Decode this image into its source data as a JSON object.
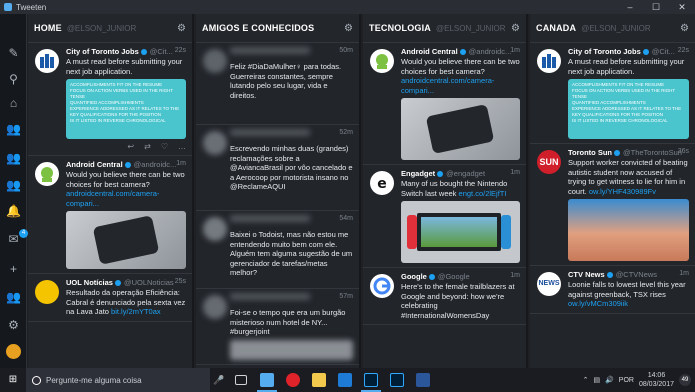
{
  "window": {
    "title": "Tweeten"
  },
  "columns": [
    {
      "title": "HOME",
      "handle": "@ELSON_JUNIOR"
    },
    {
      "title": "AMIGOS E CONHECIDOS",
      "handle": ""
    },
    {
      "title": "TECNOLOGIA",
      "handle": "@ELSON_JUNIOR"
    },
    {
      "title": "CANADA",
      "handle": "@ELSON_JUNIOR"
    }
  ],
  "home": [
    {
      "name": "City of Toronto Jobs",
      "handle": "@Cit...",
      "time": "22s",
      "text": "A must read before submitting your next job application."
    },
    {
      "name": "Android Central",
      "handle": "@androidc...",
      "time": "1m",
      "text": "Would you believe there can be two choices for best camera?",
      "link": "androidcentral.com/camera-compari..."
    },
    {
      "name": "UOL Notícias",
      "handle": "@UOLNoticias",
      "time": "25s",
      "text": "Resultado da operação Eficiência: Cabral é denunciado pela sexta vez na Lava Jato",
      "link": "bit.ly/2mYT0ax"
    }
  ],
  "amigos": [
    {
      "time": "50m",
      "text": "Feliz #DiaDaMulher♀ para todas. Guerreiras constantes, sempre lutando pelo seu lugar, vida e direitos."
    },
    {
      "time": "52m",
      "text": "Escrevendo minhas duas (grandes) reclamações sobre a @AviancaBrasil por vôo cancelado e a Aerocoop por motorista insano no @ReclameAQUI"
    },
    {
      "time": "54m",
      "text": "Baixei o Todoist, mas não estou me entendendo muito bem com ele. Alguém tem alguma sugestão de um gerenciador de tarefas/metas melhor?"
    },
    {
      "time": "57m",
      "text": "Foi-se o tempo que era um burgão misterioso num hotel de NY... #burgerjoint"
    }
  ],
  "tecnologia": [
    {
      "name": "Android Central",
      "handle": "@androidc...",
      "time": "1m",
      "text": "Would you believe there can be two choices for best camera?",
      "link": "androidcentral.com/camera-compari..."
    },
    {
      "name": "Engadget",
      "handle": "@engadget",
      "time": "1m",
      "text": "Many of us bought the Nintendo Switch last week",
      "link": "engt.co/2lEjfTI"
    },
    {
      "name": "Google",
      "handle": "@Google",
      "time": "1m",
      "text": "Here's to the female trailblazers at Google and beyond: how we're celebrating #InternationalWomensDay"
    }
  ],
  "canada": [
    {
      "name": "City of Toronto Jobs",
      "handle": "@Cit...",
      "time": "22s",
      "text": "A must read before submitting your next job application."
    },
    {
      "name": "Toronto Sun",
      "handle": "@TheTorontoSun",
      "time": "36s",
      "text": "Support worker convicted of beating autistic student now accused of trying to get witness to lie for him in court.",
      "link": "ow.ly/YHF430989Fv"
    },
    {
      "name": "CTV News",
      "handle": "@CTVNews",
      "time": "1m",
      "text": "Loonie falls to lowest level this year against greenback, TSX rises",
      "link": "ow.ly/vMCm309iik"
    }
  ],
  "job_card_lines": [
    "ACCOMPLISHMENTS FIT ON THE RESUME",
    "FOCUS ON ACTION VERBS USED IN THE RIGHT TENSE",
    "QUANTIFIED ACCOMPLISHMENTS",
    "EXPERIENCE ADDRESSED AS IT RELATES TO THE KEY QUALIFICATIONS FOR THE POSITION",
    "IS IT LISTED IN REVERSE CHRONOLOGICAL"
  ],
  "sidebar": {
    "notif_count": "4"
  },
  "taskbar": {
    "search_placeholder": "Pergunte-me alguma coisa",
    "lang": "POR",
    "time": "14:06",
    "date": "08/03/2017",
    "notifications": "49"
  }
}
